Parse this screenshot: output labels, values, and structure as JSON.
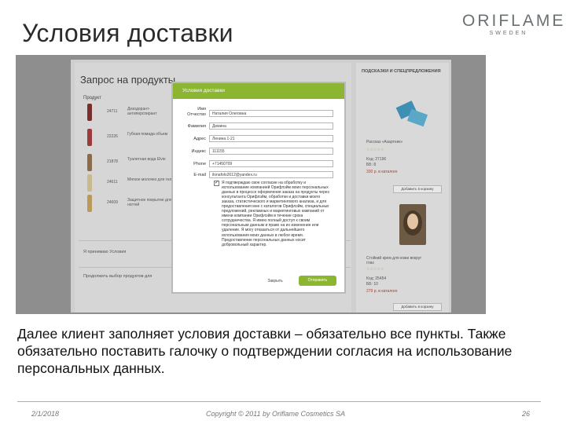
{
  "slide": {
    "title": "Условия доставки",
    "logo_main": "ORIFLAME",
    "logo_sub": "SWEDEN",
    "caption": "Далее клиент заполняет условия доставки – обязательно все пункты. Также обязательно поставить галочку о подтверждении согласия на использование персональных данных.",
    "footer_date": "2/1/2018",
    "footer_copyright": "Copyright © 2011 by Oriflame Cosmetics SA",
    "footer_page": "26"
  },
  "screenshot": {
    "page_heading": "Запрос на продукты",
    "column_product": "Продукт",
    "right_heading": "ПОДСКАЗКИ И СПЕЦПРЕДЛОЖЕНИЯ",
    "products": [
      {
        "code": "24711",
        "name": "Дезодорант-антиперспирант",
        "color": "#7a2e2e"
      },
      {
        "code": "22226",
        "name": "Губная помада объем",
        "color": "#9b3b3b"
      },
      {
        "code": "21878",
        "name": "Туалетная вода Elvie",
        "color": "#8a6b4a"
      },
      {
        "code": "24611",
        "name": "Мягкое молочко для тела",
        "color": "#c9b98e"
      },
      {
        "code": "24609",
        "name": "Защитное покрытие для ногтей",
        "color": "#b89a5a"
      }
    ],
    "left_bottom_1": "Я принимаю Условия",
    "left_bottom_2": "Продолжить выбор продуктов для",
    "right_items": [
      {
        "title": "Рассказ «Азартник»",
        "code": "Код: 27196",
        "bonus": "ББ: 8",
        "price": "330 р. в каталоге",
        "button": "Добавить в корзину"
      },
      {
        "title": "Стойкий крем для кожи вокруг глаз",
        "code": "Код: 25454",
        "bonus": "ББ: 10",
        "price": "279 р. в каталоге",
        "button": "Добавить в корзину"
      }
    ]
  },
  "modal": {
    "title": "Условия доставки",
    "fields": [
      {
        "label": "Имя Отчество",
        "value": "Наталия Олеговна"
      },
      {
        "label": "Фамилия",
        "value": "Демина"
      },
      {
        "label": "Адрес",
        "value": "Ленина 1-21"
      },
      {
        "label": "Индекс",
        "value": "111155"
      },
      {
        "label": "Phone",
        "value": "+71450709"
      },
      {
        "label": "E-mail",
        "value": "ilonafolo2612@yandex.ru"
      }
    ],
    "consent_checked": "✓",
    "consent_text": "Я подтверждаю свое согласие на обработку и использование компанией Орифлэйм моих персональных данных в процессе оформления заказа на продукты через консультанта Орифлэйм, обработки и доставки моего заказа, статистического и маркетингового анализа, и для предоставления мне с каталогов Орифлэйм, специальных предложений, рекламных и маркетинговых кампаний от имени компании Орифлэйм в течение срока сотрудничества. Я имею полный доступ к своим персональным данным и право на их изменение или удаление. Я могу отказаться от дальнейшего использования моих данных в любое время. Предоставление персональных данных носит добровольный характер.",
    "cancel_label": "Закрыть",
    "submit_label": "Отправить"
  },
  "colors": {
    "accent_green": "#8cb532",
    "footer_line": "#b9b086"
  }
}
